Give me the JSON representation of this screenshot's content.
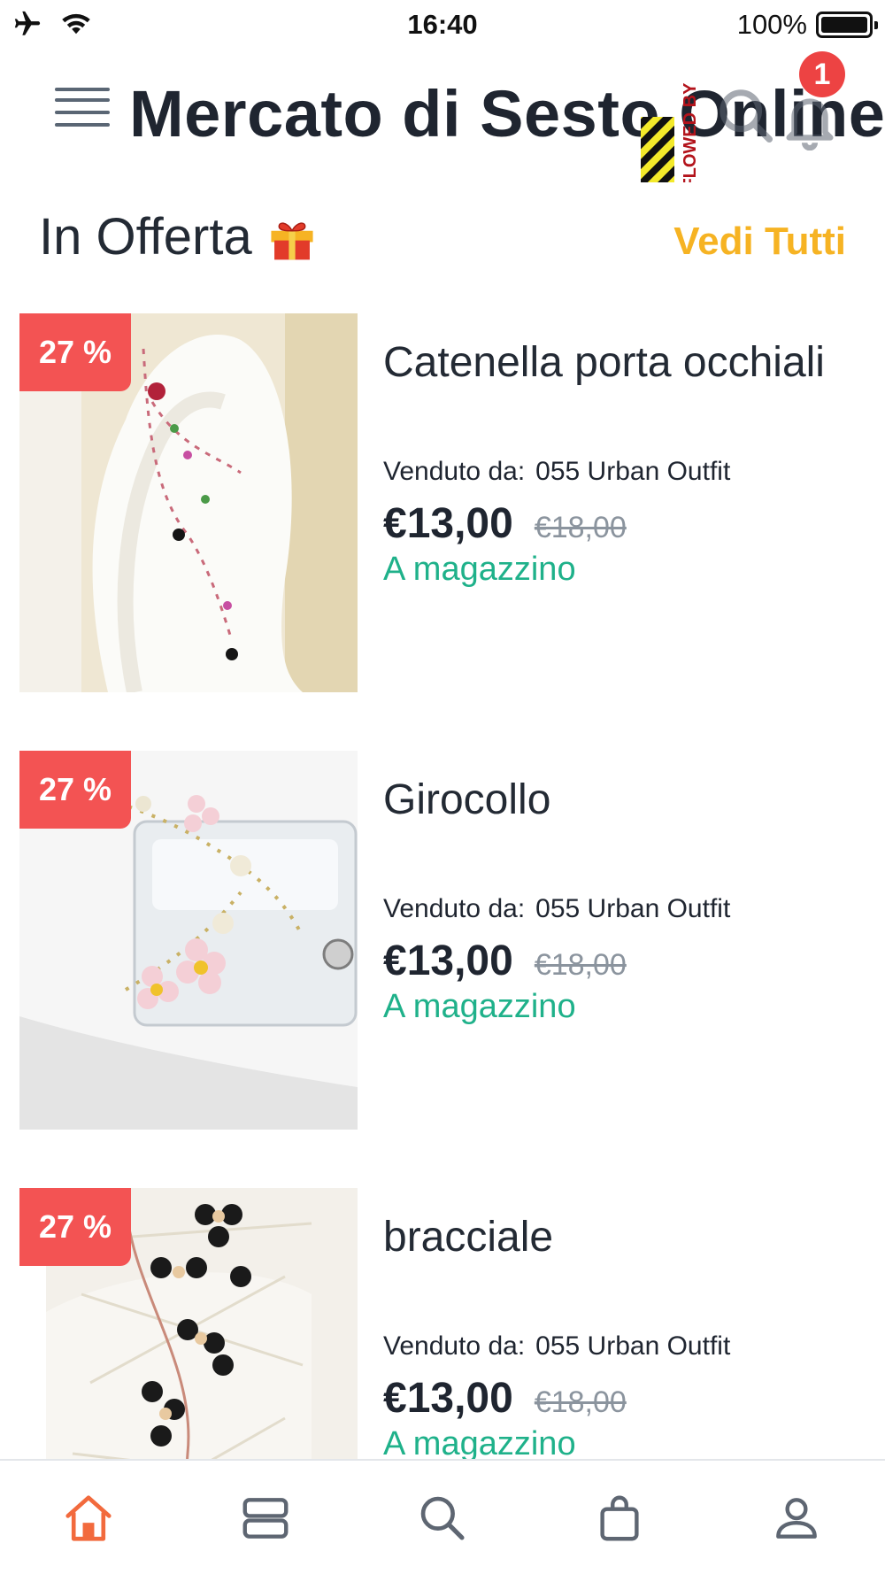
{
  "status_bar": {
    "time": "16:40",
    "battery_pct": "100%",
    "icons": [
      "airplane-icon",
      "wifi-icon",
      "battery-icon"
    ]
  },
  "header": {
    "title": "Mercato di Sesto Online",
    "watermark": "RFLOWED BY",
    "notification_count": "1",
    "icons": [
      "menu-icon",
      "search-icon",
      "bell-icon"
    ]
  },
  "section": {
    "title": "In Offerta",
    "emoji": "🎁",
    "see_all": "Vedi Tutti"
  },
  "products": [
    {
      "discount": "27 %",
      "name": "Catenella porta occhiali",
      "seller_label": "Venduto da:",
      "seller": "055 Urban Outfit",
      "price": "€13,00",
      "old_price": "€18,00",
      "stock": "A magazzino"
    },
    {
      "discount": "27 %",
      "name": "Girocollo",
      "seller_label": "Venduto da:",
      "seller": "055 Urban Outfit",
      "price": "€13,00",
      "old_price": "€18,00",
      "stock": "A magazzino"
    },
    {
      "discount": "27 %",
      "name": "bracciale",
      "seller_label": "Venduto da:",
      "seller": "055 Urban Outfit",
      "price": "€13,00",
      "old_price": "€18,00",
      "stock": "A magazzino"
    }
  ],
  "bottom_nav": {
    "items": [
      "home-icon",
      "categories-icon",
      "search-icon",
      "cart-icon",
      "account-icon"
    ],
    "active_index": 0
  },
  "colors": {
    "accent": "#f6b323",
    "discount_bg": "#f35353",
    "stock_green": "#1fb18a",
    "nav_active": "#f26a3d",
    "nav_inactive": "#5e6672",
    "badge_red": "#ed4343"
  }
}
